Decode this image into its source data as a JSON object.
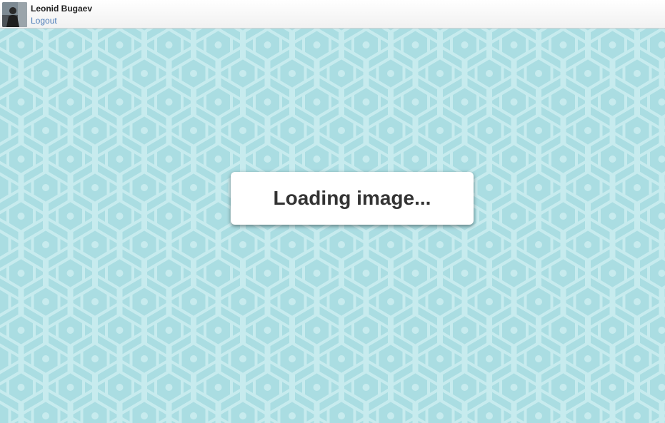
{
  "header": {
    "user_name": "Leonid Bugaev",
    "logout_label": "Logout"
  },
  "loading": {
    "message": "Loading image..."
  },
  "colors": {
    "background": "#aadde2",
    "pattern": "#c7ebee",
    "link": "#4a7bb7"
  }
}
